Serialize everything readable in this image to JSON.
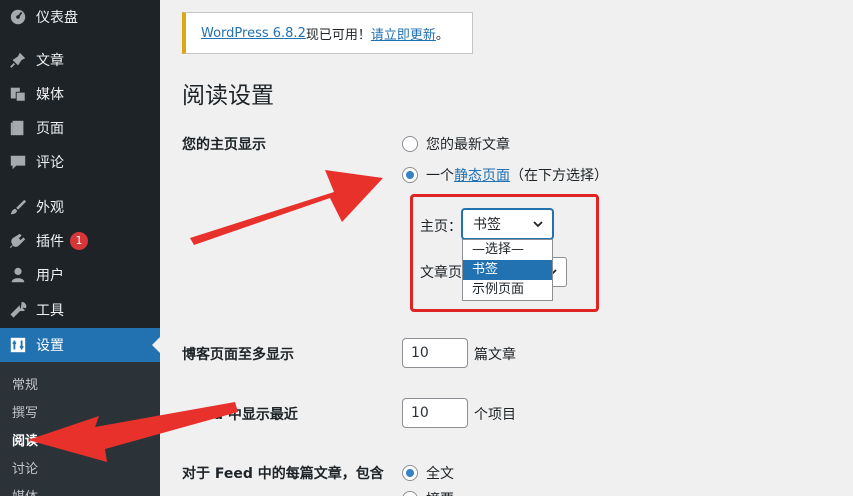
{
  "sidebar": {
    "items": [
      {
        "label": "仪表盘",
        "icon": "dashboard-icon"
      },
      {
        "label": "文章",
        "icon": "pin-icon"
      },
      {
        "label": "媒体",
        "icon": "media-icon"
      },
      {
        "label": "页面",
        "icon": "page-icon"
      },
      {
        "label": "评论",
        "icon": "comment-icon"
      },
      {
        "label": "外观",
        "icon": "brush-icon"
      },
      {
        "label": "插件",
        "icon": "plugin-icon",
        "badge": "1"
      },
      {
        "label": "用户",
        "icon": "user-icon"
      },
      {
        "label": "工具",
        "icon": "wrench-icon"
      },
      {
        "label": "设置",
        "icon": "settings-icon",
        "active": true
      }
    ],
    "submenu": [
      "常规",
      "撰写",
      "阅读",
      "讨论",
      "媒体"
    ],
    "submenu_current": "阅读"
  },
  "notice": {
    "version_link": "WordPress 6.8.2",
    "text": " 现已可用！",
    "update_link": "请立即更新",
    "tail": "。"
  },
  "page": {
    "title": "阅读设置"
  },
  "homepage": {
    "label": "您的主页显示",
    "option_latest": "您的最新文章",
    "option_static_prefix": "一个",
    "option_static_link": "静态页面",
    "option_static_suffix": "（在下方选择）",
    "front_label": "主页：",
    "front_value": "书签",
    "posts_label": "文章页",
    "dropdown_options": [
      "—选择—",
      "书签",
      "示例页面"
    ],
    "dropdown_highlighted": "书签"
  },
  "blog_pages": {
    "label": "博客页面至多显示",
    "value": "10",
    "unit": "篇文章"
  },
  "feed_items": {
    "label": "eed 中显示最近",
    "value": "10",
    "unit": "个项目"
  },
  "feed_content": {
    "label": "对于 Feed 中的每篇文章，包含",
    "option_full": "全文",
    "option_excerpt": "摘要"
  },
  "colors": {
    "accent": "#2271b1",
    "sidebar": "#1d2327",
    "annotation": "#e8312b"
  }
}
